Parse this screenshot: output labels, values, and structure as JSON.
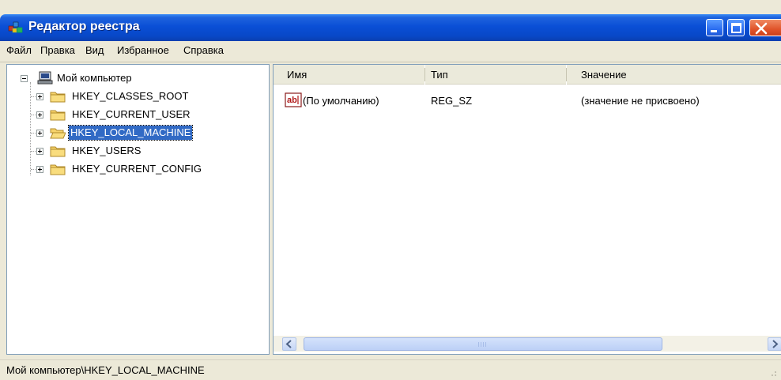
{
  "window": {
    "title": "Редактор реестра",
    "title_bar_color": "#0a4fd6",
    "icons": [
      "registry-editor-app-icon",
      "minimize-icon",
      "maximize-icon",
      "close-icon"
    ]
  },
  "menu": [
    "Файл",
    "Правка",
    "Вид",
    "Избранное",
    "Справка"
  ],
  "tree": {
    "root": {
      "label": "Мой компьютер",
      "icon": "computer-icon",
      "expanded": true
    },
    "children": [
      {
        "label": "HKEY_CLASSES_ROOT",
        "icon": "folder-icon",
        "selected": false
      },
      {
        "label": "HKEY_CURRENT_USER",
        "icon": "folder-icon",
        "selected": false
      },
      {
        "label": "HKEY_LOCAL_MACHINE",
        "icon": "open-folder-icon",
        "selected": true
      },
      {
        "label": "HKEY_USERS",
        "icon": "folder-icon",
        "selected": false
      },
      {
        "label": "HKEY_CURRENT_CONFIG",
        "icon": "folder-icon",
        "selected": false
      }
    ],
    "selection_color": "#316ac5"
  },
  "list": {
    "columns": [
      "Имя",
      "Тип",
      "Значение"
    ],
    "rows": [
      {
        "name": "(По умолчанию)",
        "type": "REG_SZ",
        "value": "(значение не присвоено)",
        "icon": "string-value-icon"
      }
    ]
  },
  "status": {
    "path": "Мой компьютер\\HKEY_LOCAL_MACHINE"
  }
}
